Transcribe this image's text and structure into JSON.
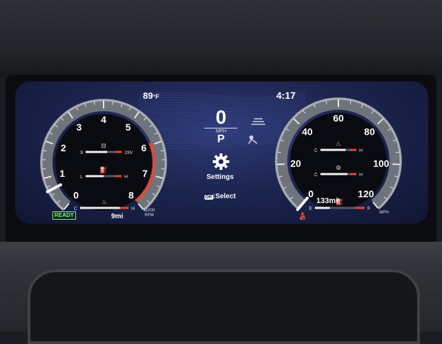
{
  "outside_temp": {
    "value": "89",
    "unit": "°F"
  },
  "clock": "4:17",
  "center": {
    "speed_value": "0",
    "speed_unit": "MPH",
    "gear": "P",
    "settings_label": "Settings",
    "select_hint": ":Select",
    "ok_label": "OK"
  },
  "left_gauge": {
    "ticks": [
      "0",
      "1",
      "2",
      "3",
      "4",
      "5",
      "6",
      "7",
      "8"
    ],
    "unit_line1": "x1000",
    "unit_line2": "RPM",
    "current_rpm_fraction": 0.08,
    "battery": {
      "min": "9",
      "max": "19V",
      "fraction": 0.6
    },
    "oil_pressure": {
      "min": "L",
      "max": "H",
      "fraction": 0.5
    },
    "coolant_temp": {
      "min": "C",
      "max": "H",
      "fraction": 0.85
    },
    "status_label": "READY",
    "range": "9mi"
  },
  "right_gauge": {
    "ticks": [
      "0",
      "20",
      "40",
      "60",
      "80",
      "100",
      "120"
    ],
    "unit": "MPH",
    "current_speed_fraction": 0.0,
    "oil_temp": {
      "min": "C",
      "max": "H",
      "fraction": 0.7
    },
    "trans_temp": {
      "min": "C",
      "max": "H",
      "fraction": 0.75
    },
    "fuel": {
      "min": "E",
      "max": "F",
      "range": "133mi",
      "fraction": 0.3
    }
  },
  "colors": {
    "accent_red": "#e8482e",
    "ready_green": "#7cff5a",
    "screen_blue": "#1d2550",
    "gauge_ring": "#8b8e95"
  }
}
